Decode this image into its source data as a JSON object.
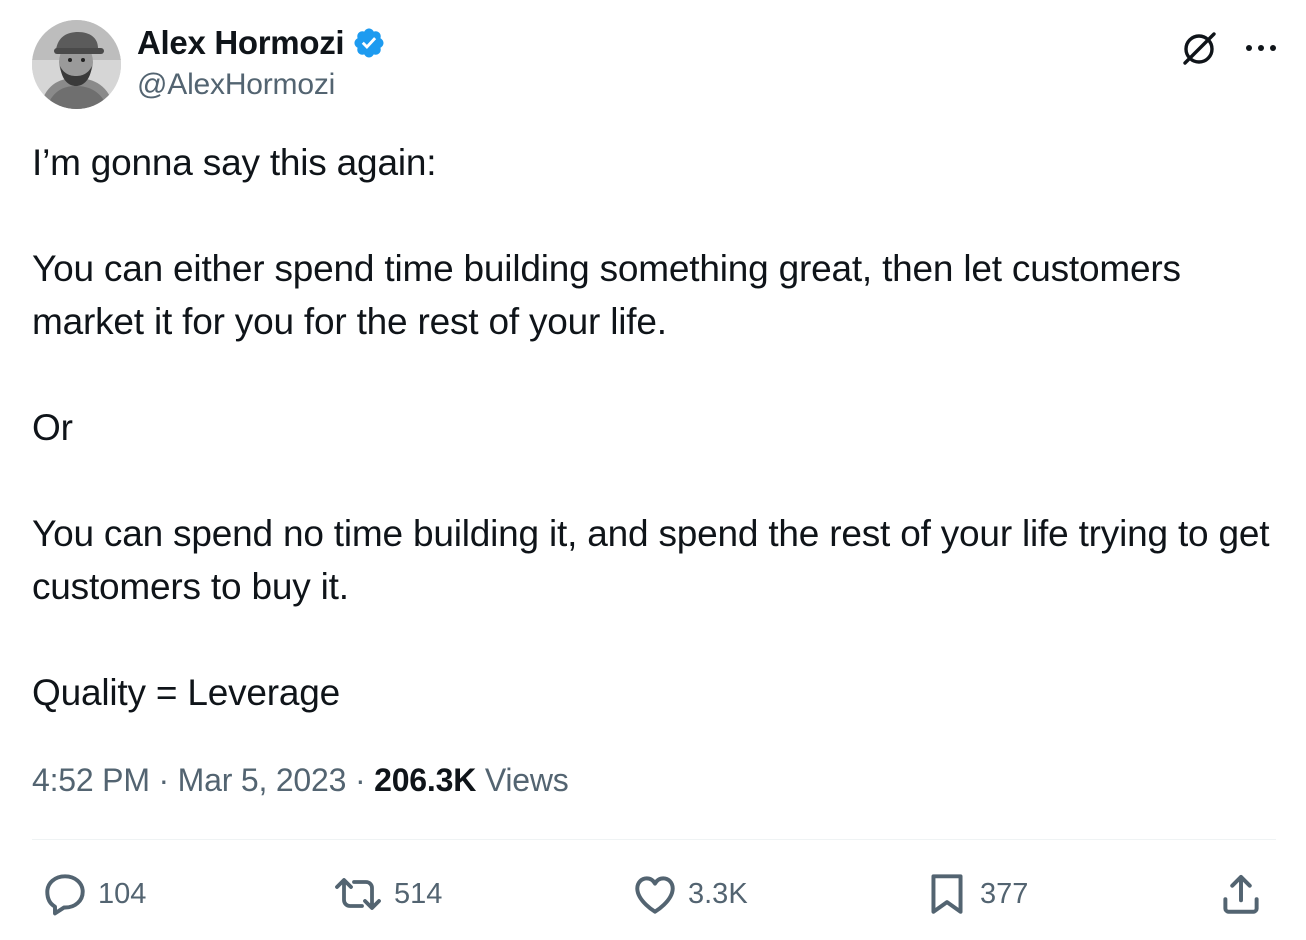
{
  "author": {
    "display_name": "Alex Hormozi",
    "handle": "@AlexHormozi",
    "verified": true
  },
  "icons": {
    "verified": "verified-badge-icon",
    "grok": "grok-icon",
    "more": "more-options-icon",
    "reply": "reply-icon",
    "retweet": "retweet-icon",
    "like": "like-icon",
    "bookmark": "bookmark-icon",
    "share": "share-icon"
  },
  "colors": {
    "verified_badge": "#1d9bf0",
    "text_primary": "#0f1419",
    "text_secondary": "#536471",
    "divider": "#eff3f4"
  },
  "tweet": {
    "paragraphs": [
      "I’m gonna say this again:",
      "You can either spend time building something great, then let customers market it for you for the rest of your life.",
      "Or",
      "You can spend no time building it, and spend the rest of your life trying to get customers to buy it.",
      "Quality = Leverage"
    ]
  },
  "meta": {
    "time": "4:52 PM",
    "separator": "·",
    "date": "Mar 5, 2023",
    "views_count": "206.3K",
    "views_label": "Views"
  },
  "actions": {
    "replies": "104",
    "retweets": "514",
    "likes": "3.3K",
    "bookmarks": "377"
  }
}
